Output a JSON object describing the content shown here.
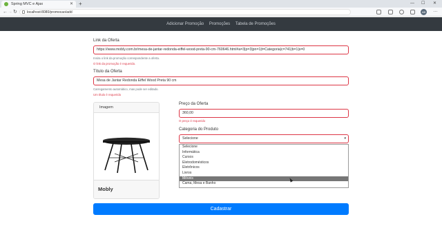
{
  "browser": {
    "tab_title": "Spring MVC e Ajax",
    "url": "localhost:8080/promocao/add",
    "profile_initials": "AB"
  },
  "navbar": {
    "links": [
      "Adicionar Promoção",
      "Promoções",
      "Tabela de Promoções"
    ]
  },
  "form": {
    "link": {
      "label": "Link da Oferta",
      "value": "https://www.mobly.com.br/mesa-de-jantar-redonda-eiffel-wood-preta-90-cm-760646.html#a=3|p=3|pn=1|t=Categoria|c=741|b=1|s=0",
      "help": "Insira o link da promoção correspondente a oferta.",
      "error": "O link da promoção é requerido."
    },
    "title": {
      "label": "Título da Oferta",
      "value": "Mesa de Jantar Redonda Eiffel Wood Preta 90 cm",
      "help": "Carregamento automático, mas pode ser editado.",
      "error": "Um título é requerido"
    },
    "image_card": {
      "header": "Imagem",
      "site": "Mobly"
    },
    "price": {
      "label": "Preço da Oferta",
      "value": "360,00",
      "error": "O preço é requerido"
    },
    "category": {
      "label": "Categoria do Produto",
      "selected": "Selecione",
      "options": [
        "Selecione",
        "Informática",
        "Cursos",
        "Eletrodomésticos",
        "Eletrônicos",
        "Livros",
        "Móveis",
        "Cama, Mesa e Banho"
      ],
      "highlighted_index": 6
    },
    "submit_label": "Cadastrar"
  },
  "colors": {
    "navbar": "#343a40",
    "error": "#dc3545",
    "primary": "#007bff"
  }
}
